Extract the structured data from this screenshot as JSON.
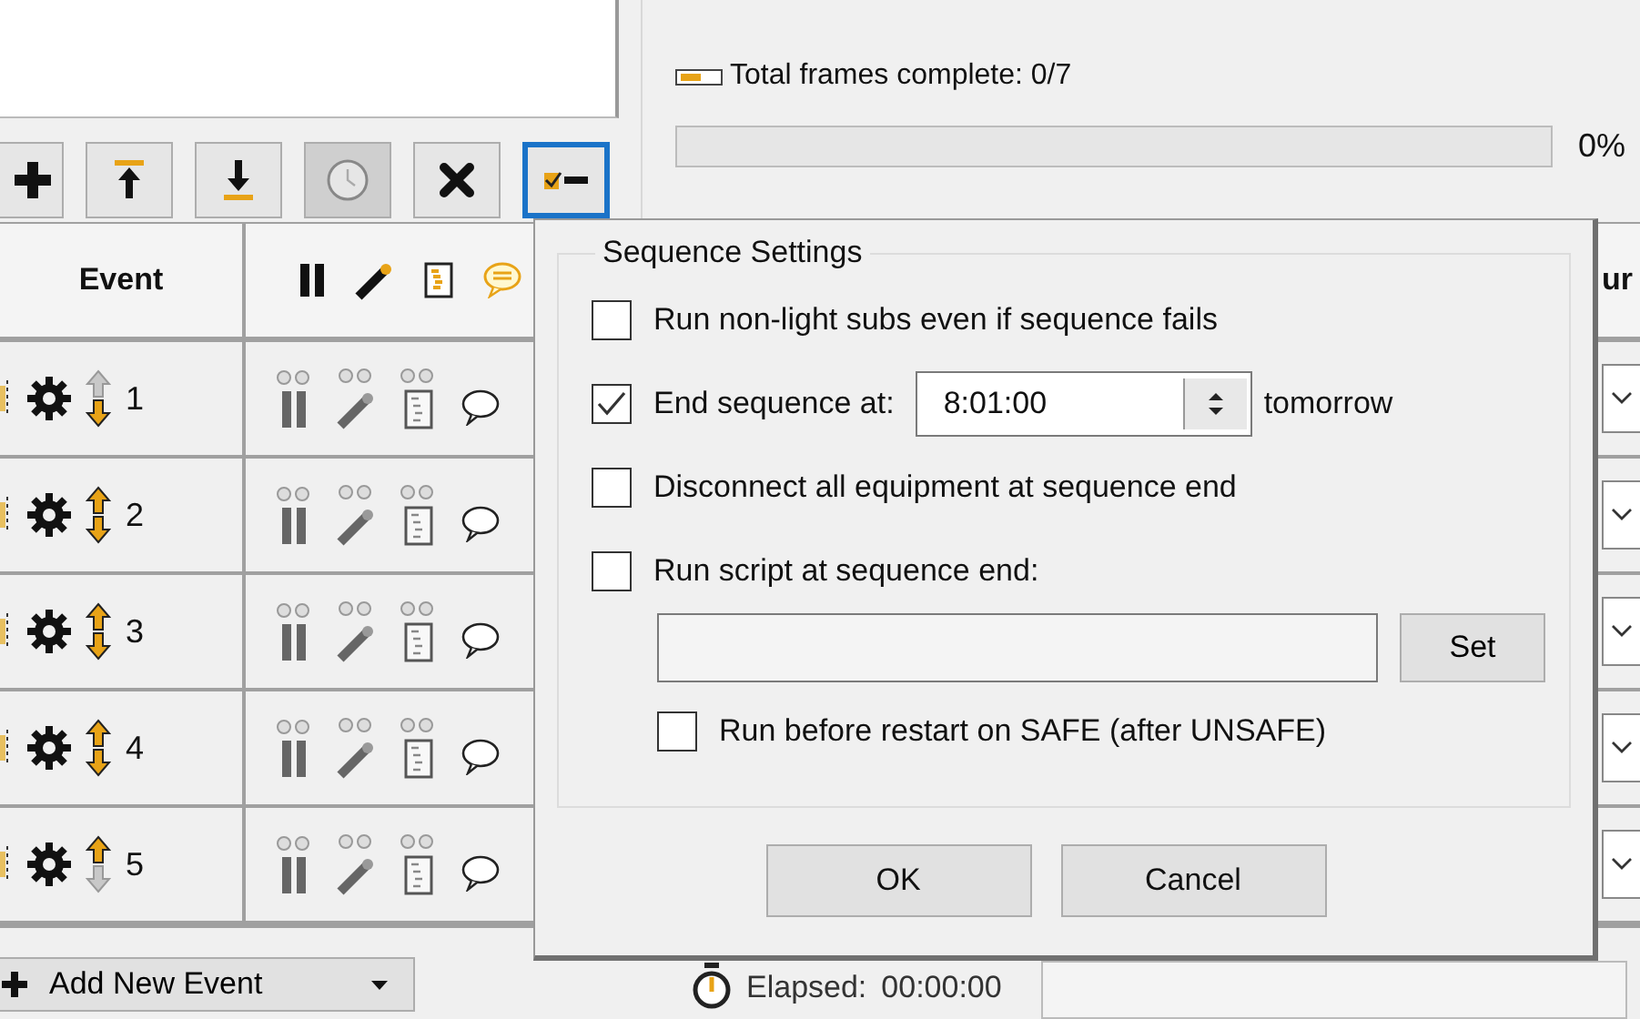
{
  "top_panel": {
    "frames_text": "Total frames complete: 0/7",
    "progress": {
      "level": 0,
      "percent": "0%"
    }
  },
  "toolbar": [
    {
      "kind": "add",
      "disabled": false,
      "selected": false
    },
    {
      "kind": "move_top",
      "disabled": false,
      "selected": false
    },
    {
      "kind": "move_bottom",
      "disabled": false,
      "selected": false
    },
    {
      "kind": "clock",
      "disabled": true,
      "selected": false
    },
    {
      "kind": "delete",
      "disabled": false,
      "selected": false
    },
    {
      "kind": "settings",
      "disabled": false,
      "selected": true
    }
  ],
  "table": {
    "columns": [
      {
        "kind": "text",
        "heading": "Event"
      },
      {
        "kind": "icons"
      },
      {
        "kind": "text",
        "heading": "ur"
      }
    ],
    "rows": [
      {
        "number": "1",
        "up_enabled": false,
        "down_enabled": true
      },
      {
        "number": "2",
        "up_enabled": true,
        "down_enabled": true
      },
      {
        "number": "3",
        "up_enabled": true,
        "down_enabled": true
      },
      {
        "number": "4",
        "up_enabled": true,
        "down_enabled": true
      },
      {
        "number": "5",
        "up_enabled": true,
        "down_enabled": false
      }
    ]
  },
  "dialog": {
    "group_title": "Sequence Settings",
    "options": [
      {
        "kind": "checkbox",
        "label": "Run non-light subs even if sequence fails",
        "checked": false
      },
      {
        "kind": "time",
        "label": "End sequence at:",
        "checked": true,
        "value": "8:01:00",
        "suffix": "tomorrow"
      },
      {
        "kind": "checkbox",
        "label": "Disconnect all equipment at sequence end",
        "checked": false
      },
      {
        "kind": "script",
        "label": "Run script at sequence end:",
        "checked": false,
        "button": "Set"
      },
      {
        "kind": "sub_checkbox",
        "label": "Run before restart on SAFE (after UNSAFE)",
        "checked": false
      }
    ],
    "buttons": [
      "OK",
      "Cancel"
    ]
  },
  "bottom_bar": {
    "add_button": "Add New Event",
    "elapsed_label": "Elapsed:",
    "elapsed_value": "00:00:00"
  }
}
